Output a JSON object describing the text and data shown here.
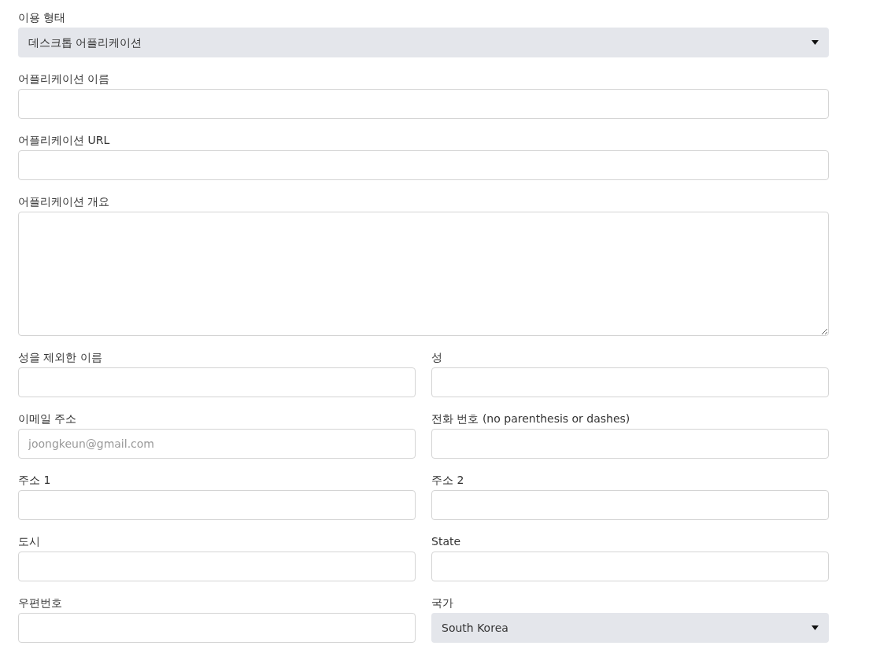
{
  "rows": [
    [
      {
        "kind": "select",
        "label": "이용 형태",
        "value": "데스크톱 어플리케이션"
      }
    ],
    [
      {
        "kind": "text",
        "label": "어플리케이션 이름"
      }
    ],
    [
      {
        "kind": "text",
        "label": "어플리케이션 URL"
      }
    ],
    [
      {
        "kind": "textarea",
        "label": "어플리케이션 개요"
      }
    ],
    [
      {
        "kind": "text",
        "label": "성을 제외한 이름"
      },
      {
        "kind": "text",
        "label": "성"
      }
    ],
    [
      {
        "kind": "text",
        "label": "이메일 주소",
        "placeholder": "joongkeun@gmail.com"
      },
      {
        "kind": "text",
        "label": "전화 번호 (no parenthesis or dashes)"
      }
    ],
    [
      {
        "kind": "text",
        "label": "주소 1"
      },
      {
        "kind": "text",
        "label": "주소 2"
      }
    ],
    [
      {
        "kind": "text",
        "label": "도시"
      },
      {
        "kind": "text",
        "label": "State"
      }
    ],
    [
      {
        "kind": "text",
        "label": "우편번호"
      },
      {
        "kind": "select",
        "label": "국가",
        "value": "South Korea"
      }
    ]
  ]
}
